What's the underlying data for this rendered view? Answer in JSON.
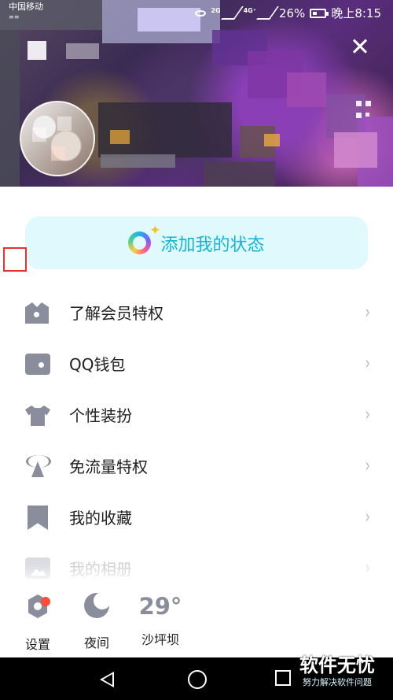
{
  "statusbar": {
    "carrier": "中国移动",
    "carrier_sub": "≡≡",
    "signal_2g": "2G",
    "signal_4g": "4G⁺",
    "battery": "26%",
    "time": "晚上8:15"
  },
  "header": {
    "close_symbol": "✕"
  },
  "status_card": {
    "label": "添加我的状态"
  },
  "menu": {
    "items": [
      {
        "label": "了解会员特权",
        "chevron": "›"
      },
      {
        "label": "QQ钱包",
        "chevron": "›"
      },
      {
        "label": "个性装扮",
        "chevron": "›"
      },
      {
        "label": "免流量特权",
        "chevron": "›"
      },
      {
        "label": "我的收藏",
        "chevron": "›"
      },
      {
        "label": "我的相册",
        "chevron": "›"
      }
    ]
  },
  "bottom": {
    "settings": "设置",
    "night": "夜间",
    "temperature": "29°",
    "location": "沙坪坝"
  },
  "watermark": {
    "main": "软件无忧",
    "sub": "努力解决软件问题"
  },
  "icons": {
    "close": "close-icon",
    "qr": "qr-code-icon",
    "status": "status-ring-icon",
    "crown": "crown-icon",
    "wallet": "wallet-icon",
    "shirt": "shirt-icon",
    "antenna": "antenna-icon",
    "bookmark": "bookmark-icon",
    "photo": "photo-album-icon",
    "settings": "settings-icon",
    "night": "moon-icon"
  },
  "colors": {
    "status_card_bg": "#dff9fd",
    "status_card_text": "#13b5d6",
    "icon_gray": "#8a8e9c",
    "notification_red": "#ff4b3a",
    "highlight_box": "#ef2f2f"
  }
}
